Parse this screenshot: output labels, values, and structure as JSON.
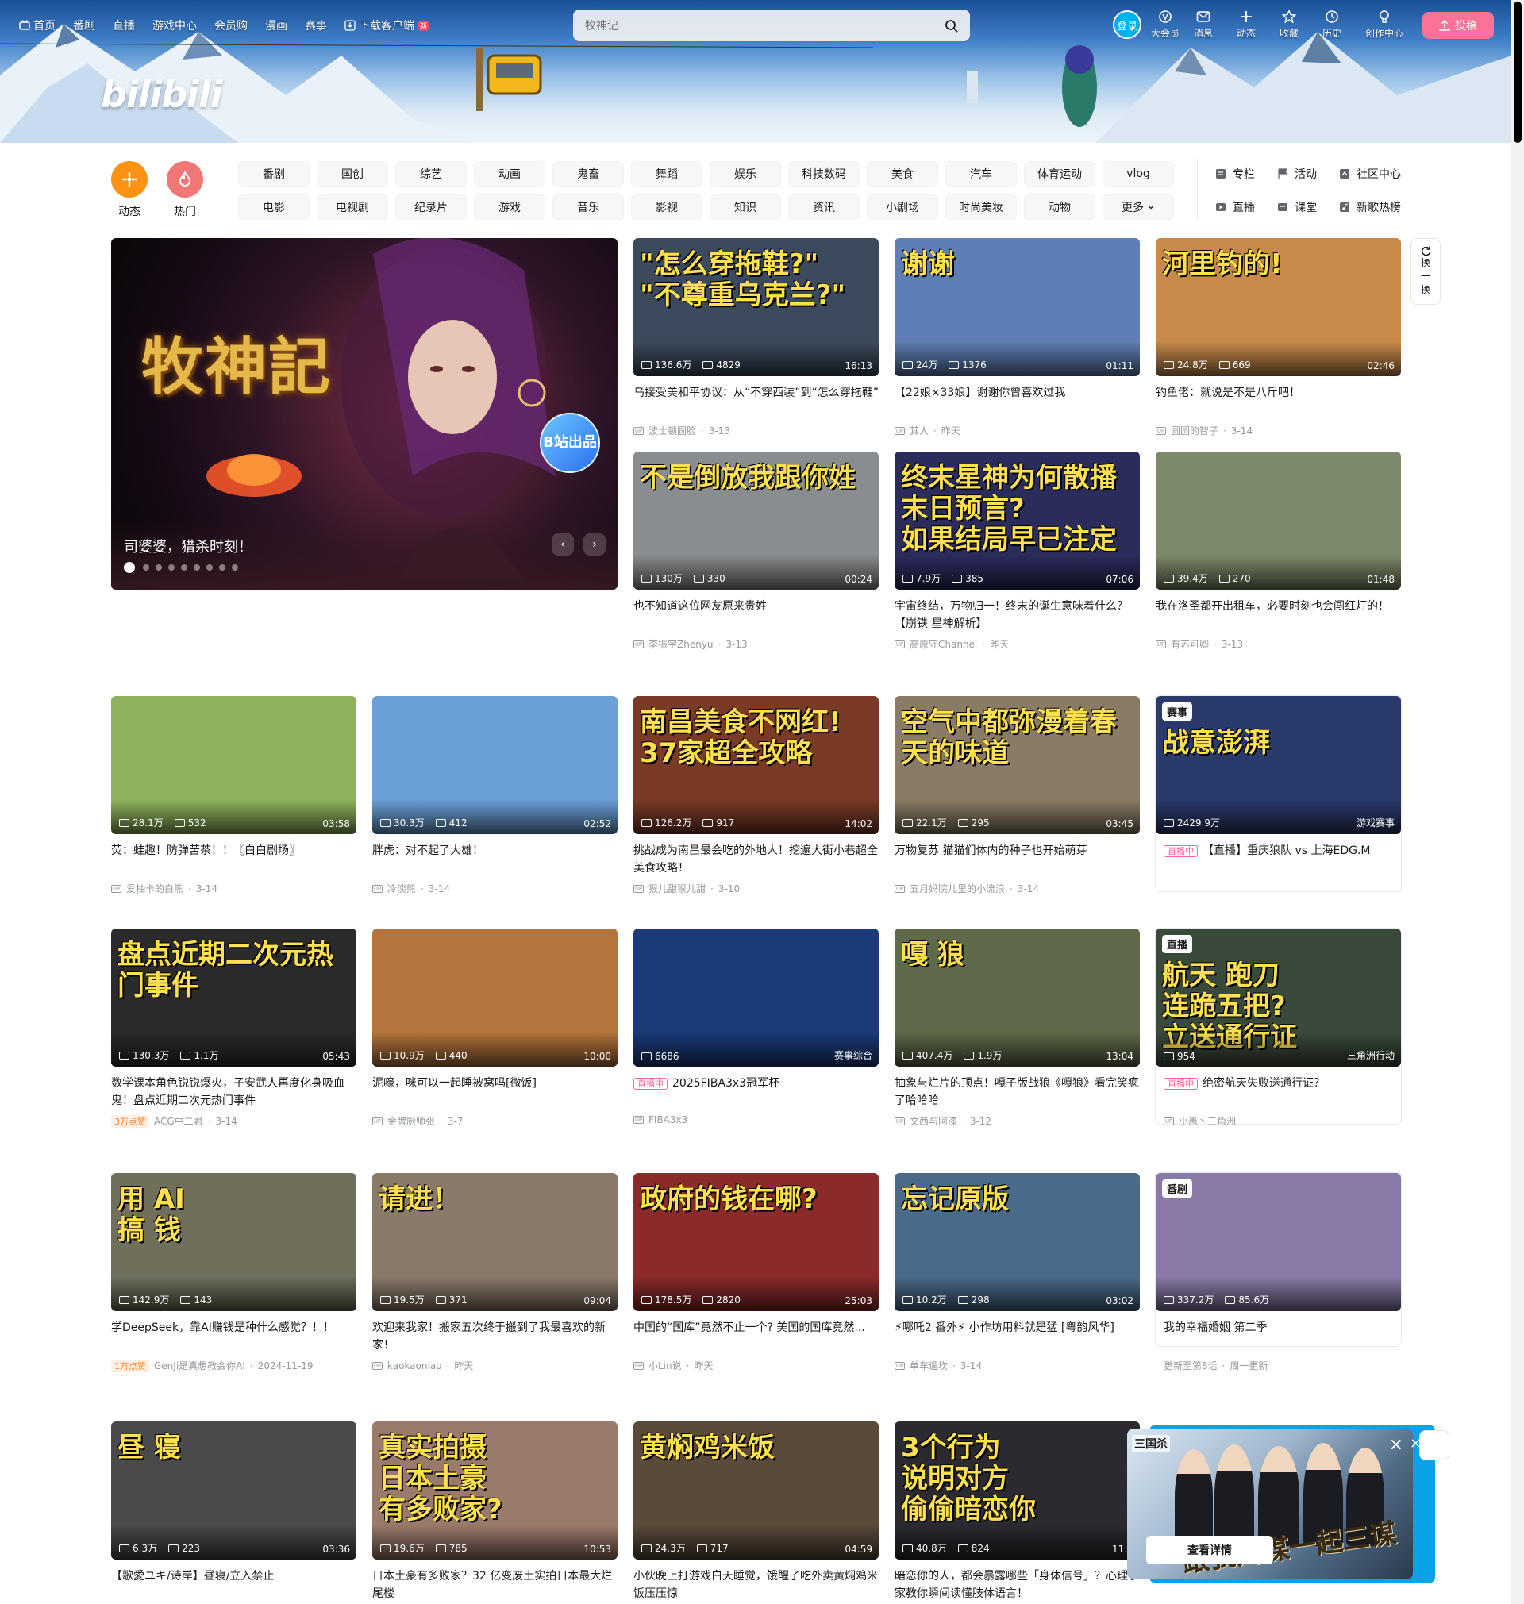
{
  "header": {
    "nav": [
      {
        "label": "首页",
        "icon": "tv-icon"
      },
      {
        "label": "番剧"
      },
      {
        "label": "直播"
      },
      {
        "label": "游戏中心"
      },
      {
        "label": "会员购"
      },
      {
        "label": "漫画"
      },
      {
        "label": "赛事"
      },
      {
        "label": "下载客户端",
        "icon": "download-icon",
        "badge": "新"
      }
    ],
    "search_placeholder": "牧神记",
    "login_label": "登录",
    "right_nav": [
      "大会员",
      "消息",
      "动态",
      "收藏",
      "历史",
      "创作中心"
    ],
    "upload_label": "投稿",
    "logo_text": "bilibili",
    "colors": {
      "accent": "#00aeec",
      "pink": "#fb7299"
    }
  },
  "channels": {
    "main": [
      {
        "label": "动态",
        "color": "#ff9212"
      },
      {
        "label": "热门",
        "color": "#f07775"
      }
    ],
    "row1": [
      "番剧",
      "国创",
      "综艺",
      "动画",
      "鬼畜",
      "舞蹈",
      "娱乐",
      "科技数码",
      "美食",
      "汽车",
      "体育运动",
      "vlog"
    ],
    "row2": [
      "电影",
      "电视剧",
      "纪录片",
      "游戏",
      "音乐",
      "影视",
      "知识",
      "资讯",
      "小剧场",
      "时尚美妆",
      "动物",
      "更多"
    ],
    "quick": [
      "专栏",
      "活动",
      "社区中心",
      "直播",
      "课堂",
      "新歌热榜"
    ]
  },
  "carousel": {
    "title_art": "牧神記",
    "badge": "B站出品",
    "caption": "司婆婆，猎杀时刻！",
    "dots": 9,
    "active_dot": 0
  },
  "refresh_label": [
    "换",
    "一",
    "换"
  ],
  "cards": [
    {
      "overlay": "\"怎么穿拖鞋?\"\n\"不尊重乌克兰?\"",
      "views": "136.6万",
      "danmaku": "4829",
      "duration": "16:13",
      "title": "乌接受美和平协议：从“不穿西装”到“怎么穿拖鞋”",
      "up": "波士顿圆脸",
      "date": "3-13",
      "bg": "#3b4a5c"
    },
    {
      "overlay": "谢谢",
      "views": "24万",
      "danmaku": "1376",
      "duration": "01:11",
      "title": "【22娘×33娘】谢谢你曾喜欢过我",
      "up": "其人",
      "date": "昨天",
      "bg": "#5e7fb5"
    },
    {
      "overlay": "河里钓的!",
      "views": "24.8万",
      "danmaku": "669",
      "duration": "02:46",
      "title": "钓鱼佬：就说是不是八斤吧！",
      "up": "圆圆的智子",
      "date": "3-14",
      "bg": "#c88a4a"
    },
    {
      "overlay": "不是倒放我跟你姓",
      "views": "130万",
      "danmaku": "330",
      "duration": "00:24",
      "title": "也不知道这位网友原来贵姓",
      "up": "李振宇Zhenyu",
      "date": "3-13",
      "bg": "#8a8d90"
    },
    {
      "overlay": "终末星神为何散播末日预言?\n如果结局早已注定",
      "views": "7.9万",
      "danmaku": "385",
      "duration": "07:06",
      "title": "宇宙终结，万物归一！终末的诞生意味着什么？【崩铁 星神解析】",
      "up": "高原守Channel",
      "date": "昨天",
      "bg": "#2a2c5c"
    },
    {
      "overlay": "",
      "views": "39.4万",
      "danmaku": "270",
      "duration": "01:48",
      "title": "我在洛圣都开出租车，必要时刻也会闯红灯的！",
      "up": "有苏可卿",
      "date": "3-13",
      "bg": "#7d8a6a"
    },
    {
      "overlay": "",
      "views": "28.1万",
      "danmaku": "532",
      "duration": "03:58",
      "title": "荧：蛙趣！防弹苦茶！！〖白白剧场〗",
      "up": "爱抽卡的白熊",
      "date": "3-14",
      "bg": "#8fb35c"
    },
    {
      "overlay": "",
      "views": "30.3万",
      "danmaku": "412",
      "duration": "02:52",
      "title": "胖虎：对不起了大雄！",
      "up": "冷淡熊",
      "date": "3-14",
      "bg": "#6aa0d8"
    },
    {
      "overlay": "南昌美食不网红!\n37家超全攻略",
      "views": "126.2万",
      "danmaku": "917",
      "duration": "14:02",
      "title": "挑战成为南昌最会吃的外地人！挖遍大街小巷超全美食攻略！",
      "up": "猴儿甜猴儿甜",
      "date": "3-10",
      "bg": "#7a3a26"
    },
    {
      "overlay": "空气中都弥漫着春天的味道",
      "views": "22.1万",
      "danmaku": "295",
      "duration": "03:45",
      "title": "万物复苏 猫猫们体内的种子也开始萌芽",
      "up": "五月妈院儿里的小流浪",
      "date": "3-14",
      "bg": "#8a7b64"
    },
    {
      "overlay": "盘点近期二次元热门事件",
      "views": "130.3万",
      "danmaku": "1.1万",
      "duration": "05:43",
      "title": "数学课本角色锐锐爆火，子安武人再度化身吸血鬼！盘点近期二次元热门事件",
      "up": "ACG中二君",
      "date": "3-14",
      "hot": "3万点赞",
      "bg": "#2b2b2b"
    },
    {
      "overlay": "",
      "views": "10.9万",
      "danmaku": "440",
      "duration": "10:00",
      "title": "泥嚎，咪可以一起睡被窝吗[微饭]",
      "up": "金牌厨师张",
      "date": "3-7",
      "bg": "#b5743c"
    },
    {
      "overlay": "嘎 狼",
      "views": "407.4万",
      "danmaku": "1.9万",
      "duration": "13:04",
      "title": "抽象与烂片的顶点！嘎子版战狼《嘎狼》看完笑疯了哈哈哈",
      "up": "文西与阿漆",
      "date": "3-12",
      "bg": "#5e6a4a"
    },
    {
      "overlay": "用 AI\n搞 钱",
      "views": "142.9万",
      "danmaku": "143",
      "duration": "",
      "title": "学DeepSeek，靠AI赚钱是种什么感觉？！！",
      "up": "GenJi是真想教会你AI",
      "date": "2024-11-19",
      "hot": "1万点赞",
      "bg": "#6f6f5c"
    },
    {
      "overlay": "请进！",
      "views": "19.5万",
      "danmaku": "371",
      "duration": "09:04",
      "title": "欢迎来我家！搬家五次终于搬到了我最喜欢的新家！",
      "up": "kaokaoniao",
      "date": "昨天",
      "bg": "#8a7a6a"
    },
    {
      "overlay": "政府的钱在哪?",
      "views": "178.5万",
      "danmaku": "2820",
      "duration": "25:03",
      "title": "中国的“国库”竟然不止一个? 美国的国库竟然...",
      "up": "小Lin说",
      "date": "昨天",
      "bg": "#8a2a2a"
    },
    {
      "overlay": "忘记原版",
      "views": "10.2万",
      "danmaku": "298",
      "duration": "03:02",
      "title": "⚡哪吒2 番外⚡ 小作坊用料就是猛 [粤韵风华]",
      "up": "单车遛坎",
      "date": "3-14",
      "bg": "#4a6a8a"
    },
    {
      "overlay": "昼 寝",
      "views": "6.3万",
      "danmaku": "223",
      "duration": "03:36",
      "title": "【歌愛ユキ/诗岸】昼寝/立入禁止",
      "up": "",
      "date": "",
      "bg": "#4a4a4a"
    },
    {
      "overlay": "真实拍摄\n日本土豪\n有多败家?",
      "views": "19.6万",
      "danmaku": "785",
      "duration": "10:53",
      "title": "日本土豪有多败家？32 亿变废土实拍日本最大烂尾楼",
      "up": "",
      "date": "",
      "bg": "#9a7a6a"
    },
    {
      "overlay": "黄焖鸡米饭",
      "views": "24.3万",
      "danmaku": "717",
      "duration": "04:59",
      "title": "小伙晚上打游戏白天睡觉，饿醒了吃外卖黄焖鸡米饭压压惊",
      "up": "",
      "date": "",
      "bg": "#5a4a3a"
    },
    {
      "overlay": "3个行为\n说明对方\n偷偷暗恋你",
      "views": "40.8万",
      "danmaku": "824",
      "duration": "11:3",
      "title": "暗恋你的人，都会暴露哪些「身体信号」？心理学家教你瞬间读懂肢体语言！",
      "up": "",
      "date": "",
      "bg": "#2a2a30"
    }
  ],
  "special_cards": [
    {
      "channel": "赛事",
      "overlay": "战意澎湃",
      "views": "2429.9万",
      "corner": "游戏赛事",
      "live": "直播中",
      "title": "【直播】重庆狼队 vs 上海EDG.M",
      "bg": "#2a3a6a"
    },
    {
      "overlay": "",
      "views": "6686",
      "corner": "赛事综合",
      "live": "直播中",
      "title": "2025FIBA3x3冠军杯",
      "up": "FIBA3x3",
      "bg": "#1a3a7a"
    },
    {
      "channel": "直播",
      "overlay": "航天 跑刀\n连跪五把?\n立送通行证",
      "views": "954",
      "corner": "三角洲行动",
      "live": "直播中",
      "title": "绝密航天失败送通行证？",
      "up": "小愚丶三角洲",
      "bg": "#3a4a3a"
    },
    {
      "channel": "番剧",
      "overlay": "",
      "views": "337.2万",
      "danmaku": "85.6万",
      "title": "我的幸福婚姻 第二季",
      "sub": "更新至第8话",
      "sub2": "周一更新",
      "bg": "#8a7aa8"
    }
  ],
  "popup": {
    "title": "三国杀",
    "slogan": "跟我刘谋一起三谋",
    "button": "查看详情"
  }
}
